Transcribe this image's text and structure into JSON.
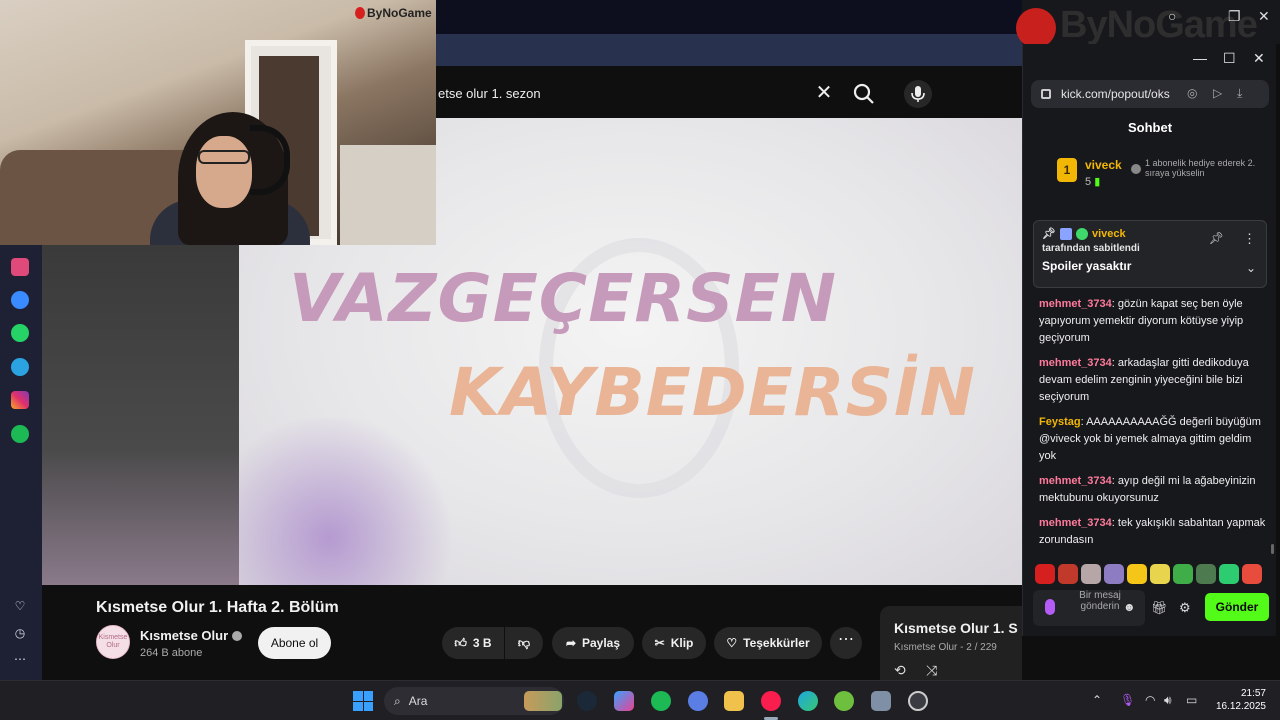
{
  "webcam": {
    "logo": "ByNoGame"
  },
  "overlay": {
    "brand": "ByNoGame"
  },
  "youtube": {
    "search_value": "etse olur 1. sezon",
    "video_title": "Kısmetse Olur 1. Hafta 2. Bölüm",
    "overlay_line1": "VAZGEÇERSEN",
    "overlay_line2": "KAYBEDERSİN",
    "channel": {
      "name": "Kısmetse Olur",
      "subs": "264 B abone",
      "avatar_text": "Kismetse Olur"
    },
    "subscribe": "Abone ol",
    "likes": "3 B",
    "share": "Paylaş",
    "clip": "Klip",
    "thanks": "Teşekkürler",
    "playlist": {
      "title": "Kısmetse Olur 1. S",
      "subtitle": "Kısmetse Olur - 2 / 229"
    }
  },
  "kick": {
    "url": "kick.com/popout/oks",
    "header": "Sohbet",
    "top_gifter": {
      "rank": "1",
      "name": "viveck",
      "count": "5",
      "note": "1 abonelik hediye ederek 2. sıraya yükselin"
    },
    "pinned": {
      "user": "viveck",
      "by": "tarafından sabitlendi",
      "message": "Spoiler yasaktır"
    },
    "messages": [
      {
        "user": "mehmet_3734",
        "color": "#ff7a9c",
        "text": ": gözün kapat seç ben öyle yapıyorum yemektir diyorum kötüyse yiyip geçiyorum"
      },
      {
        "user": "mehmet_3734",
        "color": "#ff7a9c",
        "text": ": arkadaşlar gitti dedikoduya devam edelim zenginin yiyeceğini bile bizi seçiyorum"
      },
      {
        "user": "Feystag",
        "color": "#f2b705",
        "text": ": AAAAAAAAAAĞĞ değerli büyüğüm @viveck yok bi yemek almaya gittim geldim yok"
      },
      {
        "user": "mehmet_3734",
        "color": "#ff7a9c",
        "text": ": ayıp değil mi la ağabeyinizin mektubunu okuyorsunuz"
      },
      {
        "user": "mehmet_3734",
        "color": "#ff7a9c",
        "text": ": tek yakışıklı sabahtan yapmak zorundasın"
      }
    ],
    "input_placeholder": "Bir mesaj gönderin",
    "send": "Gönder"
  },
  "taskbar": {
    "search": "Ara",
    "time": "21:57",
    "date": "16.12.2025"
  }
}
